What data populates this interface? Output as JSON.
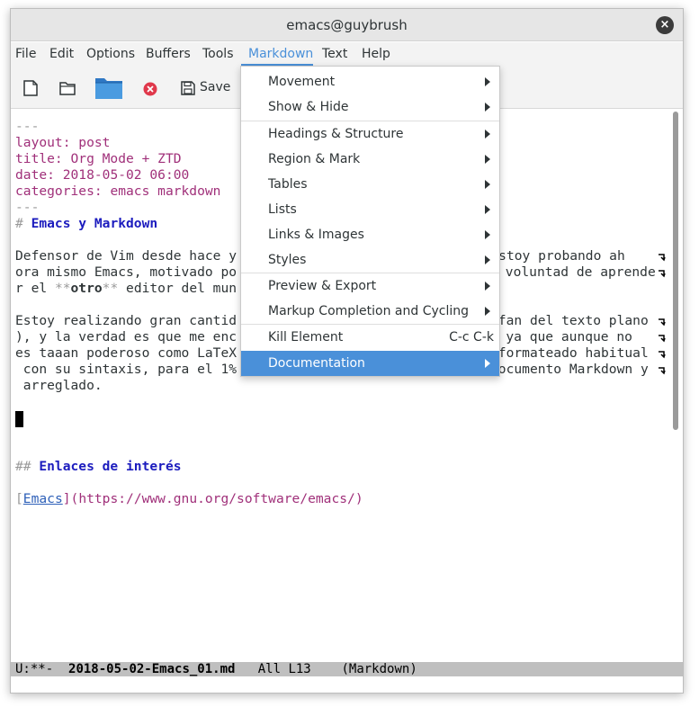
{
  "window": {
    "title": "emacs@guybrush",
    "close_glyph": "×"
  },
  "menubar": {
    "items": [
      "File",
      "Edit",
      "Options",
      "Buffers",
      "Tools",
      "Markdown",
      "Text",
      "Help"
    ],
    "active": "Markdown"
  },
  "toolbar": {
    "buttons": [
      "new-file-icon",
      "open-folder-icon",
      "dired-folder-icon",
      "close-buffer-icon",
      "save-icon"
    ],
    "save_label": "Save",
    "accent_red": "#e0384b",
    "accent_blue": "#3a86d0"
  },
  "dropdown": {
    "items": [
      {
        "label": "Movement",
        "submenu": true
      },
      {
        "label": "Show & Hide",
        "submenu": true
      },
      {
        "label": "Headings & Structure",
        "submenu": true
      },
      {
        "label": "Region & Mark",
        "submenu": true
      },
      {
        "label": "Tables",
        "submenu": true
      },
      {
        "label": "Lists",
        "submenu": true
      },
      {
        "label": "Links & Images",
        "submenu": true
      },
      {
        "label": "Styles",
        "submenu": true
      },
      {
        "label": "Preview & Export",
        "submenu": true
      },
      {
        "label": "Markup Completion and Cycling",
        "submenu": true
      },
      {
        "label": "Kill Element",
        "accel": "C-c C-k"
      },
      {
        "label": "Documentation",
        "submenu": true,
        "highlighted": true
      }
    ]
  },
  "editor": {
    "frontmatter": {
      "sep": "---",
      "layout_key": "layout:",
      "layout_val": " post",
      "title_key": "title:",
      "title_val": " Org Mode + ZTD",
      "date_key": "date:",
      "date_val": " 2018-05-02 06:00",
      "categories_key": "categories:",
      "categories_val": " emacs markdown",
      "sep_end": "---"
    },
    "h1_marker": "# ",
    "h1_text": "Emacs y Markdown",
    "para1_l1_a": "Defensor de Vim desde hace y",
    "para1_l1_b": "), estoy probando ah",
    "para1_l2_a": "ora mismo Emacs, motivado po",
    "para1_l2_b": " voluntad de aprende",
    "para1_l3_a": "r el ",
    "para1_l3_stars_open": "**",
    "para1_l3_bold": "otro",
    "para1_l3_stars_close": "**",
    "para1_l3_b": " editor del mun",
    "para2_l1_a": "Estoy realizando gran cantid",
    "para2_l1_b": "(fan del texto plano",
    "para2_l2_a": "), y la verdad es que me enc",
    "para2_l2_b": "n, ya que aunque no ",
    "para2_l3_a": "es taaan poderoso como LaTeX",
    "para2_l3_b": " formateado habitual",
    "para2_l4_a": " con su sintaxis, para el 1%",
    "para2_l4_b": "documento Markdown y",
    "para2_l5": " arreglado.",
    "h2_marker": "## ",
    "h2_text": "Enlaces de interés",
    "link_open": "[",
    "link_text": "Emacs",
    "link_mid": "](",
    "link_url": "https://www.gnu.org/software/emacs/",
    "link_close": ")"
  },
  "modeline": {
    "text_prefix": "U:**-  ",
    "filename": "2018-05-02-Emacs_01.md",
    "text_suffix": "   All L13    (Markdown)"
  }
}
